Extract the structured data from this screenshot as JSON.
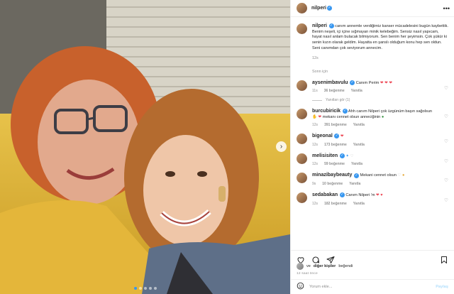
{
  "post": {
    "username": "nilperi",
    "caption": "canım annemle verdiğimiz kanser mücadelesini bugün kaybettik. Benim neşeli, içi içine sığmayan minik kelebeğim. Sensiz nasıl yapıcam, hayat nasıl anlam bulacak bilmiyorum. Sen benim her şeyimsin. Çok şükür ki senin kızın olarak geldim. Hayatta en şanslı olduğum konu hep sen oldun. Seni canımdan çok seviyorum annecim.",
    "caption_time": "12s",
    "see_translation": "Sonn için",
    "likes_prefix": "ve",
    "likes_bold": "diğer kişiler",
    "likes_suffix": "beğendi",
    "posted_ago": "12 saat önce"
  },
  "comments": [
    {
      "user": "aysenimbavulu",
      "text": "Canım Perim",
      "emoji": "❤ ❤ ❤",
      "time": "11s",
      "likes": "36 beğenme",
      "reply": "Yanıtla",
      "replies": "Yanıtları gör (1)"
    },
    {
      "user": "burcubiricik",
      "text": "Ahh canım Nilperi çok üzgünüm başın sağolsun",
      "emoji2": "mekanı cennet olsun anneciğinin",
      "time": "12s",
      "likes": "391 beğenme",
      "reply": "Yanıtla"
    },
    {
      "user": "bigeonal",
      "text": "",
      "emoji": "❤",
      "time": "12s",
      "likes": "173 beğenme",
      "reply": "Yanıtla"
    },
    {
      "user": "melisisiten",
      "text": "",
      "emoji": "♡",
      "time": "12s",
      "likes": "59 beğenme",
      "reply": "Yanıtla"
    },
    {
      "user": "minazibaybeauty",
      "text": "Mekani cennet olsun",
      "emoji": "♡",
      "time": "9s",
      "likes": "10 beğenme",
      "reply": "Yanıtla"
    },
    {
      "user": "sedabakan",
      "text": "Canım Nilperi 'm",
      "emoji": "❤",
      "time": "12s",
      "likes": "182 beğenme",
      "reply": "Yanıtla"
    }
  ],
  "composer": {
    "placeholder": "Yorum ekle...",
    "post_label": "Paylaş"
  },
  "icons": {
    "more": "more-icon",
    "like": "heart-icon",
    "comment": "comment-icon",
    "share": "share-icon",
    "save": "bookmark-icon",
    "emoji": "emoji-icon",
    "next": "chevron-right-icon"
  },
  "colors": {
    "verified": "#3897f0",
    "heart": "#ed4956",
    "muted": "#8e8e8e"
  }
}
